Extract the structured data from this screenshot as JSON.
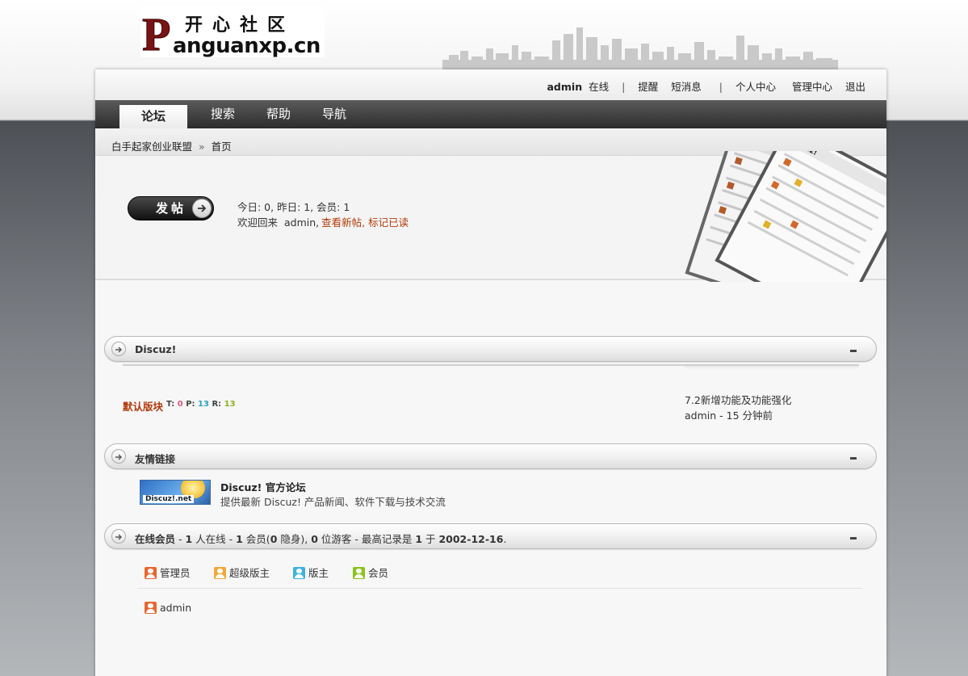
{
  "logo": {
    "brand_cn": "开心社区",
    "domain_text": "Panguanxp.cn"
  },
  "userbar": {
    "username": "admin",
    "online_label": "在线",
    "reminders": "提醒",
    "messages": "短消息",
    "profile": "个人中心",
    "admin_center": "管理中心",
    "logout": "退出"
  },
  "nav": {
    "items": [
      {
        "label": "论坛",
        "active": true
      },
      {
        "label": "搜索"
      },
      {
        "label": "帮助"
      },
      {
        "label": "导航"
      }
    ]
  },
  "breadcrumb": {
    "site": "白手起家创业联盟",
    "separator": "»",
    "current": "首页"
  },
  "hero": {
    "post_button": "发帖",
    "stats_line": "今日: 0, 昨日: 1, 会员: 1",
    "welcome_prefix": "欢迎回来",
    "welcome_user": "admin,",
    "new_posts_link": "查看新帖",
    "mark_read_link": "标记已读"
  },
  "categories": {
    "discuz": {
      "title": "Discuz!"
    },
    "links": {
      "title": "友情链接"
    },
    "online": {
      "title": "在线会员",
      "detail_parts": [
        " - ",
        "1",
        " 人在线 - ",
        "1",
        " 会员(",
        "0",
        " 隐身), ",
        "0",
        " 位游客 - 最高记录是 ",
        "1",
        " 于 ",
        "2002-12-16",
        "."
      ]
    }
  },
  "forum": {
    "name": "默认版块",
    "t_label": "T:",
    "t_value": "0",
    "p_label": "P:",
    "p_value": "13",
    "r_label": "R:",
    "r_value": "13",
    "last_post_title": "7.2新增功能及功能强化",
    "last_post_meta": "admin - 15 分钟前"
  },
  "friend_link": {
    "logo_text": "Discuz!.net",
    "title": "Discuz! 官方论坛",
    "description": "提供最新 Discuz! 产品新闻、软件下载与技术交流"
  },
  "legend": [
    {
      "label": "管理员",
      "color": "#e8662f"
    },
    {
      "label": "超级版主",
      "color": "#f0a83a"
    },
    {
      "label": "版主",
      "color": "#3cb2df"
    },
    {
      "label": "会员",
      "color": "#8cc21e"
    }
  ],
  "online_members": [
    {
      "name": "admin",
      "color": "#e8662f"
    }
  ],
  "colors": {
    "link_accent": "#b43a0a",
    "nav_dark": "#2c2c2c"
  },
  "icons": [
    "arrow-right-icon",
    "collapse-icon",
    "user-icon"
  ]
}
